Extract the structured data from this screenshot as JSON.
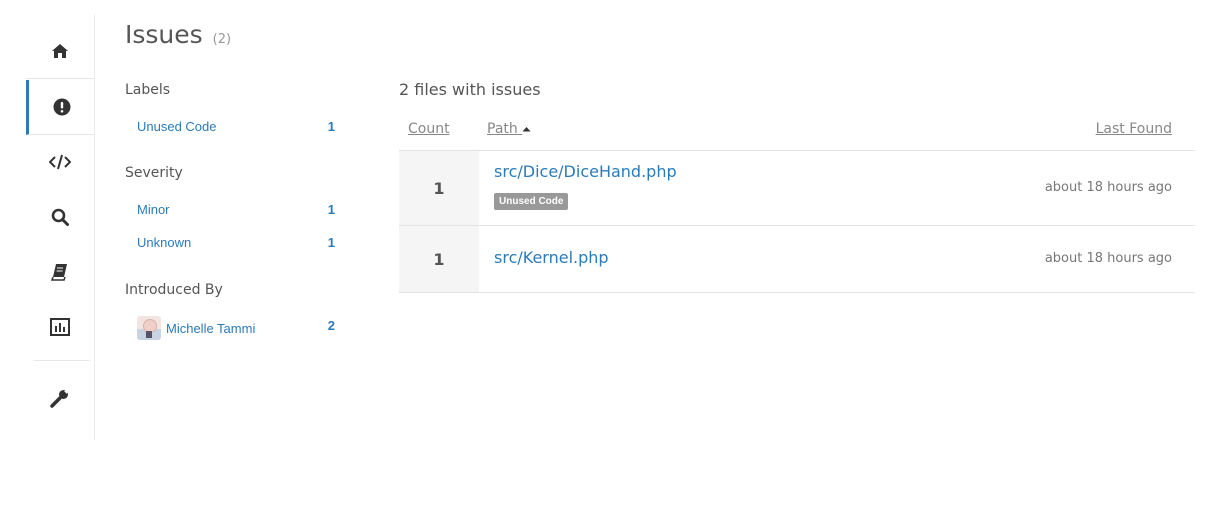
{
  "nav": {
    "items": [
      {
        "name": "home",
        "icon": "home-icon"
      },
      {
        "name": "issues",
        "icon": "exclamation-circle-icon",
        "active": true
      },
      {
        "name": "code",
        "icon": "code-icon"
      },
      {
        "name": "search",
        "icon": "search-icon"
      },
      {
        "name": "docs",
        "icon": "book-icon"
      },
      {
        "name": "stats",
        "icon": "bar-chart-icon"
      },
      {
        "name": "settings",
        "icon": "wrench-icon"
      }
    ]
  },
  "header": {
    "title": "Issues",
    "count": "(2)"
  },
  "filters": {
    "labels": {
      "heading": "Labels",
      "items": [
        {
          "label": "Unused Code",
          "count": "1"
        }
      ]
    },
    "severity": {
      "heading": "Severity",
      "items": [
        {
          "label": "Minor",
          "count": "1"
        },
        {
          "label": "Unknown",
          "count": "1"
        }
      ]
    },
    "introduced_by": {
      "heading": "Introduced By",
      "items": [
        {
          "label": "Michelle Tammi",
          "count": "2"
        }
      ]
    }
  },
  "results": {
    "heading": "2 files with issues",
    "columns": {
      "count": "Count",
      "path": "Path",
      "last_found": "Last Found"
    },
    "rows": [
      {
        "count": "1",
        "path": "src/Dice/DiceHand.php",
        "tag": "Unused Code",
        "last_found": "about 18 hours ago"
      },
      {
        "count": "1",
        "path": "src/Kernel.php",
        "last_found": "about 18 hours ago"
      }
    ]
  },
  "colors": {
    "accent": "#2b7bb9",
    "tag_bg": "#999999",
    "count_cell_bg": "#f5f5f5"
  }
}
